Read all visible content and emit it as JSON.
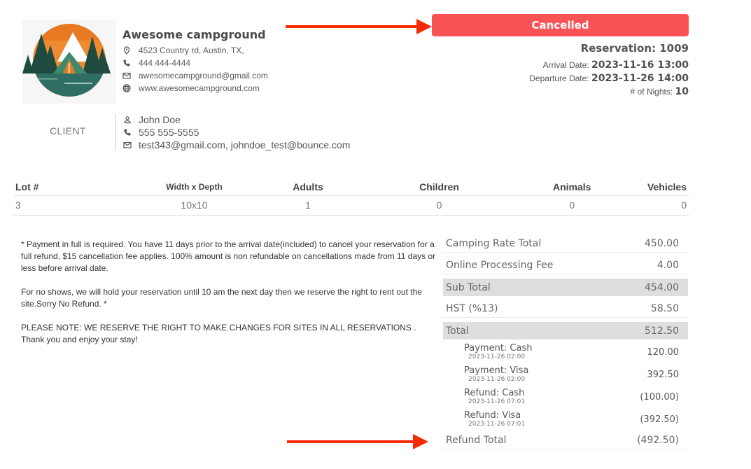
{
  "campground": {
    "logo_alt": "campground-logo",
    "name": "Awesome campground",
    "address": "4523 Country rd, Austin, TX,",
    "phone": "444 444-4444",
    "email": "awesomecampground@gmail.com",
    "website": "www.awesomecampground.com"
  },
  "status": {
    "label": "Cancelled",
    "color": "#fa5356"
  },
  "annotation_color": "#f52b08",
  "reservation": {
    "number_label": "Reservation: 1009",
    "arrival_label": "Arrival Date:",
    "arrival_value": "2023-11-16 13:00",
    "departure_label": "Departure Date:",
    "departure_value": "2023-11-26 14:00",
    "nights_label": "# of Nights:",
    "nights_value": "10"
  },
  "client": {
    "section_label": "CLIENT",
    "name": "John Doe",
    "phone": "555 555-5555",
    "emails": "test343@gmail.com, johndoe_test@bounce.com"
  },
  "lot_table": {
    "headers": [
      "Lot #",
      "Width x Depth",
      "Adults",
      "Children",
      "Animals",
      "Vehicles"
    ],
    "rows": [
      [
        "3",
        "10x10",
        "1",
        "0",
        "0",
        "0"
      ]
    ]
  },
  "policy": {
    "paragraph1": "* Payment in full is required. You have 11 days prior to the arrival date(included) to cancel your reservation for a full refund, $15 cancellation fee applies. 100% amount is non refundable on cancellations made from 11 days or less before arrival date.",
    "paragraph2": "For no shows, we will hold your reservation until 10 am the next day then we reserve the right to rent out the site.Sorry No Refund. *",
    "paragraph3_line1": "PLEASE NOTE: WE RESERVE THE RIGHT TO MAKE CHANGES FOR SITES IN ALL RESERVATIONS .",
    "paragraph3_line2": "Thank you and enjoy your stay!"
  },
  "summary": {
    "lines": [
      {
        "label": "Camping Rate Total",
        "value": "450.00"
      },
      {
        "label": "Online Processing Fee",
        "value": "4.00"
      },
      {
        "label": "Sub Total",
        "value": "454.00"
      },
      {
        "label": "HST (%13)",
        "value": "58.50"
      },
      {
        "label": "Total",
        "value": "512.50"
      }
    ],
    "transactions": [
      {
        "label": "Payment: Cash",
        "date": "2023-11-26 02:00",
        "amount": "120.00"
      },
      {
        "label": "Payment: Visa",
        "date": "2023-11-26 02:00",
        "amount": "392.50"
      },
      {
        "label": "Refund: Cash",
        "date": "2023-11-26 07:01",
        "amount": "(100.00)"
      },
      {
        "label": "Refund: Visa",
        "date": "2023-11-26 07:01",
        "amount": "(392.50)"
      }
    ],
    "refund_total_label": "Refund Total",
    "refund_total_value": "(492.50)"
  }
}
